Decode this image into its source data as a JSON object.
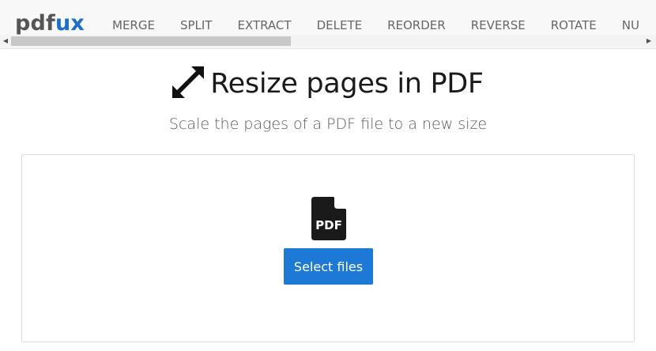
{
  "logo": {
    "part1": "pdf",
    "part2": "ux"
  },
  "nav": {
    "items": [
      "MERGE",
      "SPLIT",
      "EXTRACT",
      "DELETE",
      "REORDER",
      "REVERSE",
      "ROTATE",
      "NU"
    ]
  },
  "heading": {
    "title": "Resize pages in PDF",
    "icon": "expand-arrows-icon"
  },
  "subtitle": "Scale the pages of a PDF file to a new size",
  "dropzone": {
    "file_icon": "pdf-file-icon",
    "file_icon_text": "PDF",
    "select_button": "Select files"
  },
  "colors": {
    "accent": "#1e78d6",
    "logo_blue": "#1e6fc8",
    "logo_gray": "#555555"
  }
}
